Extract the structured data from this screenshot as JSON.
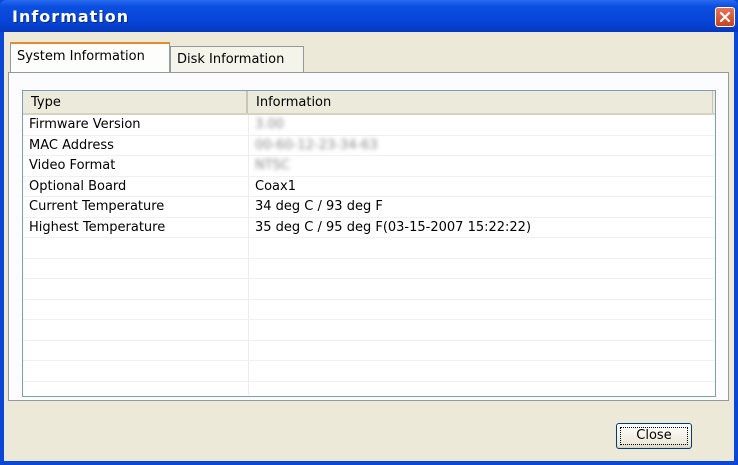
{
  "window": {
    "title": "Information"
  },
  "tabs": [
    {
      "label": "System Information",
      "active": true
    },
    {
      "label": "Disk Information",
      "active": false
    }
  ],
  "table": {
    "columns": [
      "Type",
      "Information"
    ],
    "rows": [
      {
        "type": "Firmware Version",
        "info": "3.00"
      },
      {
        "type": "MAC Address",
        "info": "00-60-12-23-34-63"
      },
      {
        "type": "Video Format",
        "info": "NTSC"
      },
      {
        "type": "Optional Board",
        "info": "Coax1"
      },
      {
        "type": "Current Temperature",
        "info": "34 deg C / 93 deg F"
      },
      {
        "type": "Highest Temperature",
        "info": "35 deg C / 95 deg F(03-15-2007 15:22:22)"
      },
      {
        "type": "",
        "info": ""
      },
      {
        "type": "",
        "info": ""
      },
      {
        "type": "",
        "info": ""
      },
      {
        "type": "",
        "info": ""
      },
      {
        "type": "",
        "info": ""
      },
      {
        "type": "",
        "info": ""
      },
      {
        "type": "",
        "info": ""
      }
    ]
  },
  "buttons": {
    "close": "Close"
  },
  "colors": {
    "titlebar": "#0644d6",
    "tab_highlight": "#e68b2c",
    "close_x": "#c8431c"
  }
}
